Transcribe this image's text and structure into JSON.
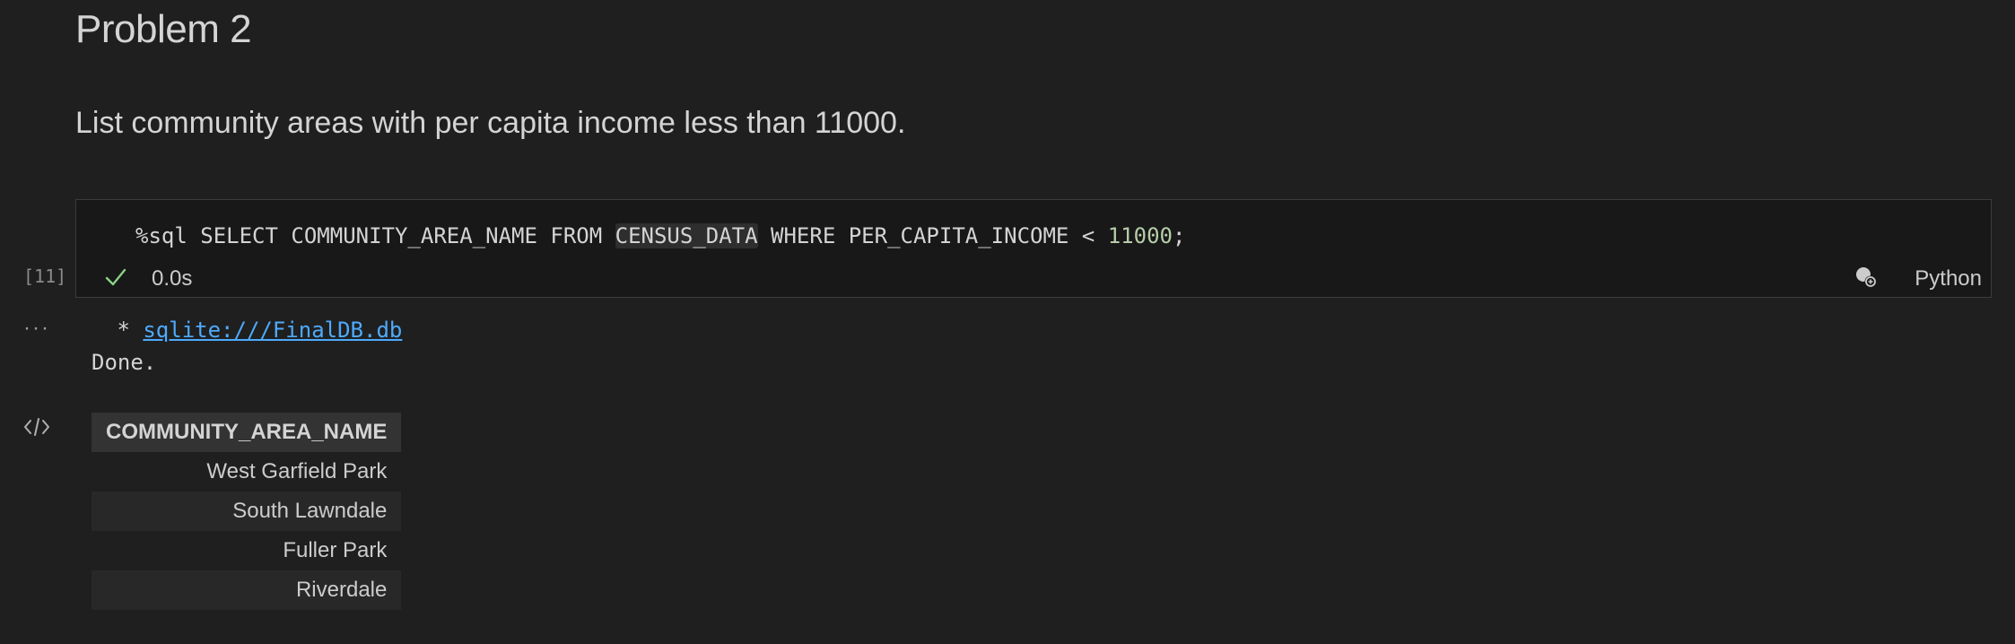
{
  "markdown": {
    "heading": "Problem 2",
    "paragraph": "List community areas with per capita income less than 11000."
  },
  "code_cell": {
    "execution_count": "[11]",
    "code": {
      "prefix": "%sql SELECT COMMUNITY_AREA_NAME FROM ",
      "table_name": "CENSUS_DATA",
      "middle": " WHERE PER_CAPITA_INCOME < ",
      "number": "11000",
      "suffix": ";"
    },
    "status_icon": "check-icon",
    "exec_time": "0.0s",
    "kernel_icon": "kernel-select-icon",
    "language": "Python"
  },
  "output": {
    "more_label": "···",
    "code_icon": "code-brackets-icon",
    "connection_prefix": " * ",
    "connection_link": "sqlite:///FinalDB.db",
    "status": "Done.",
    "table": {
      "header": "COMMUNITY_AREA_NAME",
      "rows": [
        "West Garfield Park",
        "South Lawndale",
        "Fuller Park",
        "Riverdale"
      ]
    }
  },
  "colors": {
    "background": "#1f1f1f",
    "cell_background": "#181818",
    "link": "#4daafc",
    "number": "#b5cea8",
    "success": "#89d185"
  }
}
